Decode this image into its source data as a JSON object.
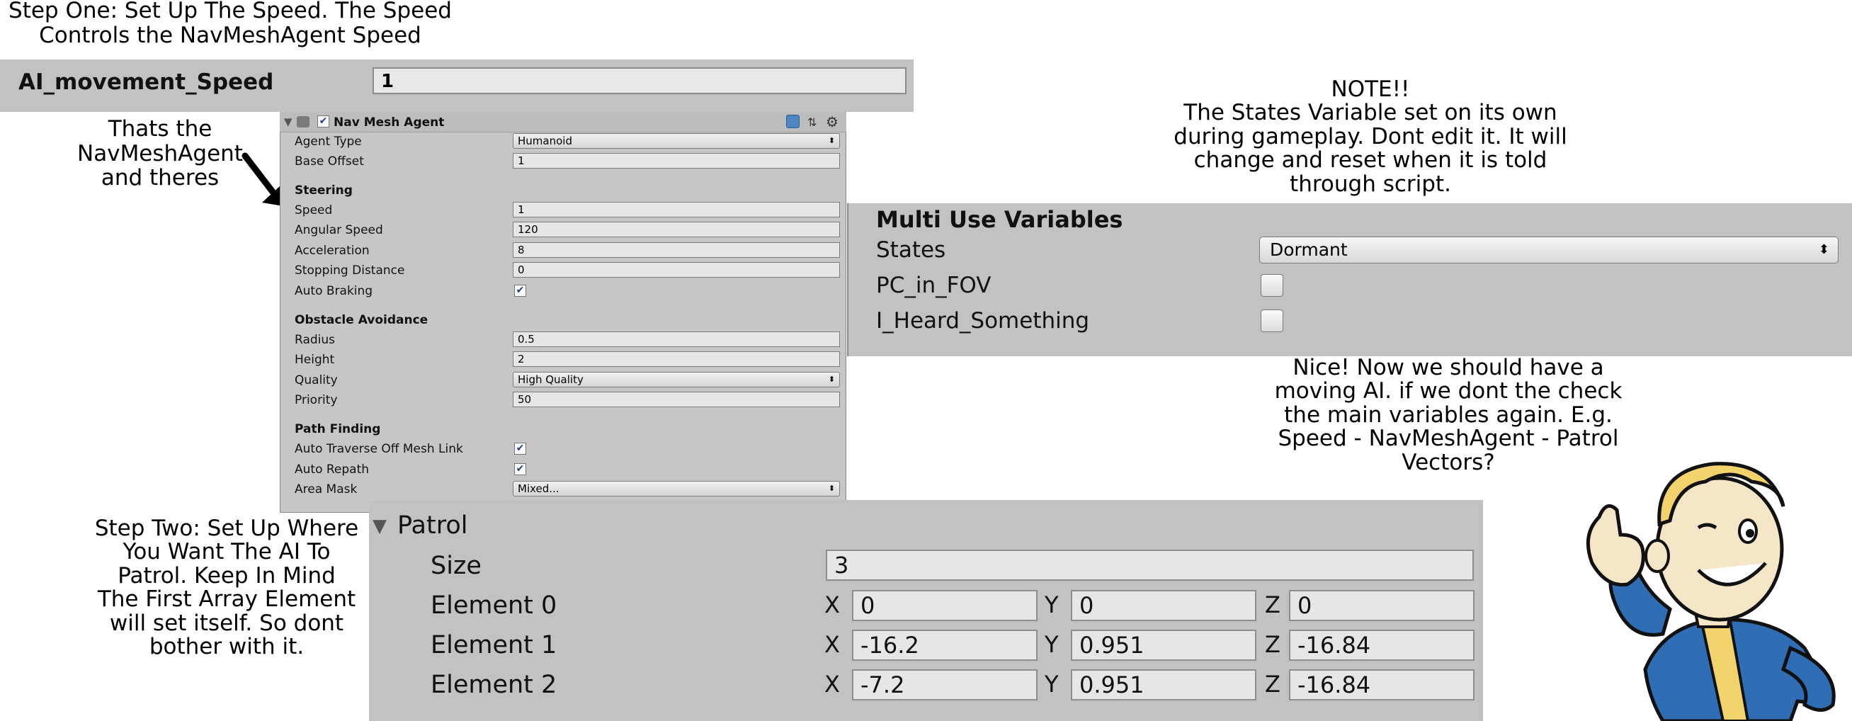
{
  "step_one_note": {
    "line1": "Step One: Set Up The Speed. The Speed",
    "line2": "Controls the NavMeshAgent Speed"
  },
  "speed_strip": {
    "label": "AI_movement_Speed",
    "value": "1"
  },
  "navmesh_note": {
    "line1": "Thats the",
    "line2": "NavMeshAgent",
    "line3": "and theres"
  },
  "nav_mesh_agent": {
    "title": "Nav Mesh Agent",
    "agent_type_label": "Agent Type",
    "agent_type_value": "Humanoid",
    "base_offset_label": "Base Offset",
    "base_offset_value": "1",
    "steering_header": "Steering",
    "speed_label": "Speed",
    "speed_value": "1",
    "angular_speed_label": "Angular Speed",
    "angular_speed_value": "120",
    "acceleration_label": "Acceleration",
    "acceleration_value": "8",
    "stopping_distance_label": "Stopping Distance",
    "stopping_distance_value": "0",
    "auto_braking_label": "Auto Braking",
    "auto_braking_checked": true,
    "obstacle_header": "Obstacle Avoidance",
    "radius_label": "Radius",
    "radius_value": "0.5",
    "height_label": "Height",
    "height_value": "2",
    "quality_label": "Quality",
    "quality_value": "High Quality",
    "priority_label": "Priority",
    "priority_value": "50",
    "path_header": "Path Finding",
    "auto_traverse_label": "Auto Traverse Off Mesh Link",
    "auto_traverse_checked": true,
    "auto_repath_label": "Auto Repath",
    "auto_repath_checked": true,
    "area_mask_label": "Area Mask",
    "area_mask_value": "Mixed...",
    "check_glyph": "✔",
    "dropdown_glyph": "⬍"
  },
  "states_note": {
    "line1": "NOTE!!",
    "line2": "The States Variable set on its own",
    "line3": "during gameplay. Dont edit it. It will",
    "line4": "change and reset when it is told",
    "line5": "through script."
  },
  "multi_use": {
    "title": "Multi Use Variables",
    "states_label": "States",
    "states_value": "Dormant",
    "pc_in_fov_label": "PC_in_FOV",
    "pc_in_fov_checked": false,
    "heard_label": "I_Heard_Something",
    "heard_checked": false
  },
  "nice_note": {
    "line1": "Nice! Now we should have a",
    "line2": "moving AI. if we dont the check",
    "line3": "the main variables again. E.g.",
    "line4": "Speed - NavMeshAgent - Patrol",
    "line5": "Vectors?"
  },
  "step_two_note": {
    "line1": "Step Two: Set Up Where",
    "line2": "You Want The AI To",
    "line3": "Patrol. Keep In Mind",
    "line4": "The First Array Element",
    "line5": "will set itself. So dont",
    "line6": "bother with it."
  },
  "patrol": {
    "title": "Patrol",
    "size_label": "Size",
    "size_value": "3",
    "x_label": "X",
    "y_label": "Y",
    "z_label": "Z",
    "elements": [
      {
        "label": "Element 0",
        "x": "0",
        "y": "0",
        "z": "0"
      },
      {
        "label": "Element 1",
        "x": "-16.2",
        "y": "0.951",
        "z": "-16.84"
      },
      {
        "label": "Element 2",
        "x": "-7.2",
        "y": "0.951",
        "z": "-16.84"
      }
    ]
  },
  "colors": {
    "panel_gray": "#c2c2c2",
    "field_gray": "#e6e6e6",
    "vault_blue": "#2f6db5",
    "vault_yellow": "#f2d36b"
  }
}
